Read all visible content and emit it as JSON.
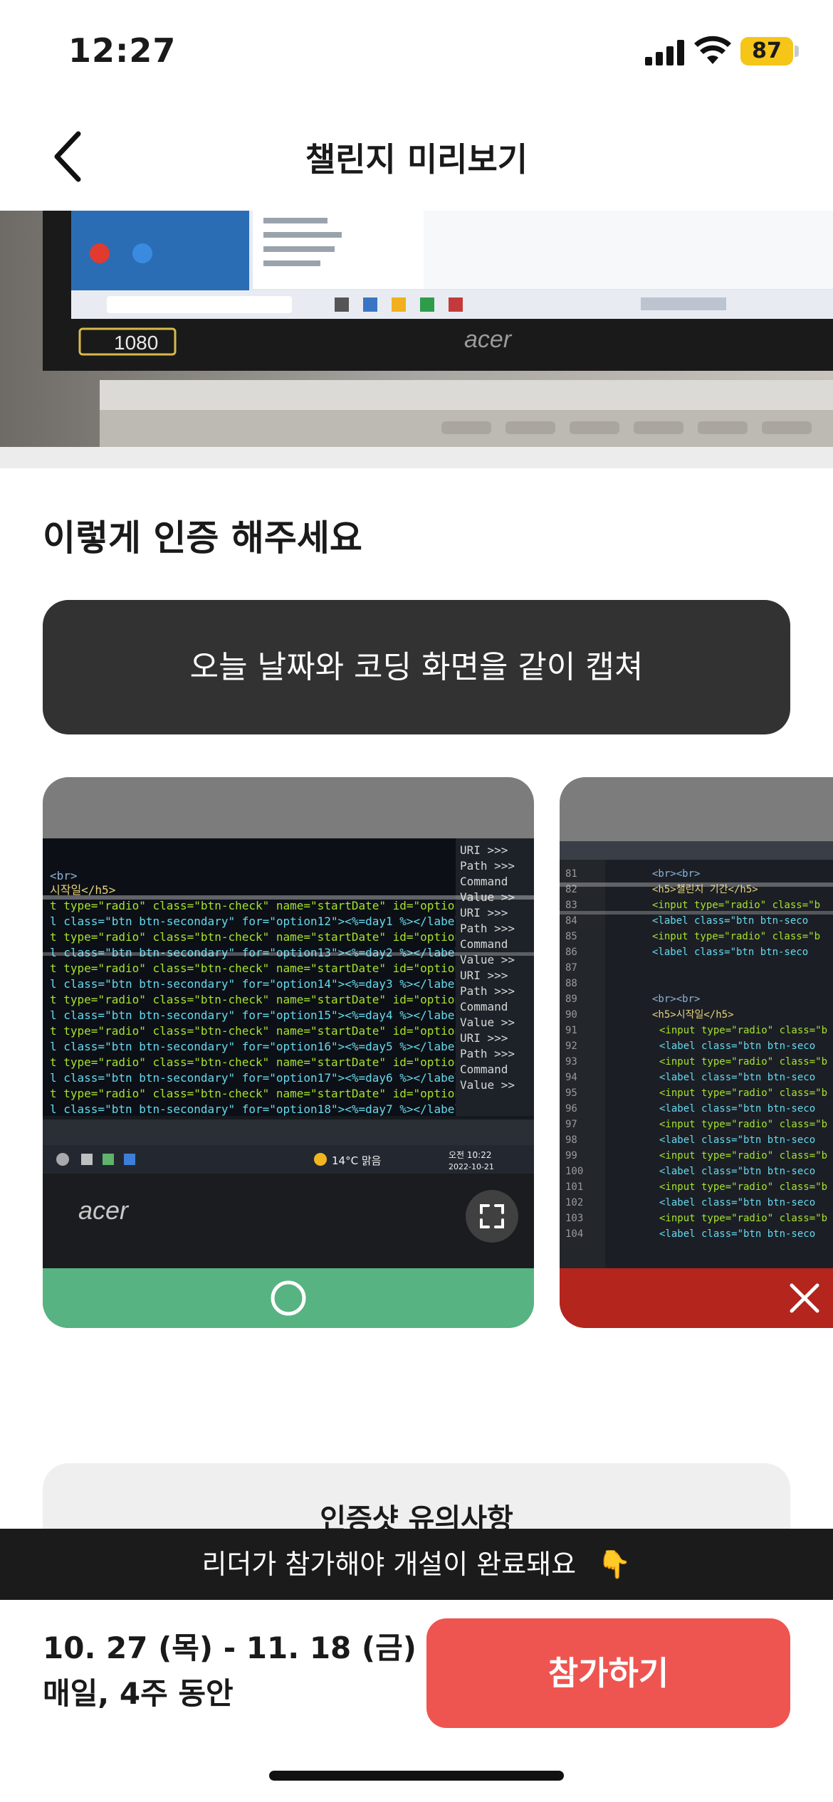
{
  "status_bar": {
    "time": "12:27",
    "battery": "87",
    "icons": [
      "signal-icon",
      "wifi-icon",
      "battery-icon"
    ]
  },
  "nav": {
    "title": "챌린지 미리보기",
    "back_icon": "chevron-left-icon"
  },
  "hero": {
    "monitor_brand": "acer",
    "resolution_badge": "1080"
  },
  "section": {
    "title": "이렇게 인증 해주세요"
  },
  "instruction": {
    "text": "오늘 날짜와 코딩 화면을 같이 캡쳐"
  },
  "examples": {
    "good": {
      "monitor_brand": "acer",
      "weather": "14°C 맑음",
      "clock_time": "오전 10:22",
      "clock_date": "2022-10-21",
      "footer_icon": "circle-icon",
      "expand_icon": "expand-icon"
    },
    "bad": {
      "footer_icon": "x-icon"
    }
  },
  "notice": {
    "title": "인증샷 유의사항"
  },
  "banner": {
    "text": "리더가 참가해야 개설이 완료돼요",
    "emoji": "👇"
  },
  "schedule": {
    "date_range": "10. 27 (목) - 11. 18 (금)",
    "frequency": "매일, 4주 동안"
  },
  "actions": {
    "join_label": "참가하기"
  },
  "colors": {
    "accent": "#ee5550",
    "good": "#57b381",
    "bad": "#b4251d",
    "battery": "#f5c518",
    "dark": "#323232"
  }
}
